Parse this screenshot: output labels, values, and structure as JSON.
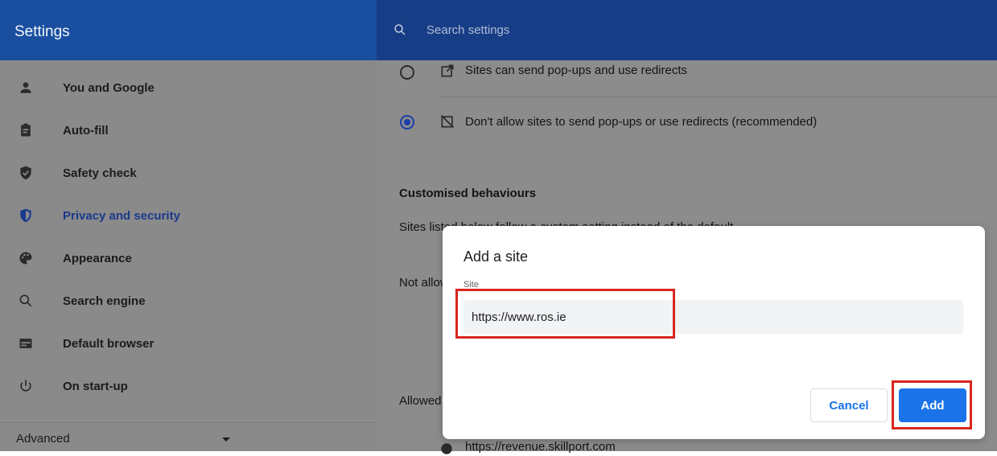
{
  "header": {
    "title": "Settings",
    "search_placeholder": "Search settings"
  },
  "sidebar": {
    "items": [
      {
        "label": "You and Google",
        "icon": "person-icon"
      },
      {
        "label": "Auto-fill",
        "icon": "clipboard-icon"
      },
      {
        "label": "Safety check",
        "icon": "shield-check-icon"
      },
      {
        "label": "Privacy and security",
        "icon": "shield-icon",
        "active": true
      },
      {
        "label": "Appearance",
        "icon": "palette-icon"
      },
      {
        "label": "Search engine",
        "icon": "search-icon"
      },
      {
        "label": "Default browser",
        "icon": "browser-icon"
      },
      {
        "label": "On start-up",
        "icon": "power-icon"
      }
    ],
    "advanced_label": "Advanced"
  },
  "main": {
    "option_allow": "Sites can send pop-ups and use redirects",
    "option_block": "Don't allow sites to send pop-ups or use redirects (recommended)",
    "customised_title": "Customised behaviours",
    "customised_desc": "Sites listed below follow a custom setting instead of the default",
    "not_allowed_label": "Not allowed to send pop-ups or use redirects",
    "allowed_label": "Allowed to send pop-ups and use redirects",
    "allowed_site": "https://revenue.skillport.com"
  },
  "dialog": {
    "title": "Add a site",
    "field_label": "Site",
    "field_value": "https://www.ros.ie",
    "cancel_label": "Cancel",
    "add_label": "Add"
  },
  "colors": {
    "brand": "#1a4fa0",
    "accent": "#1a73e8",
    "highlight": "#d9251d"
  }
}
